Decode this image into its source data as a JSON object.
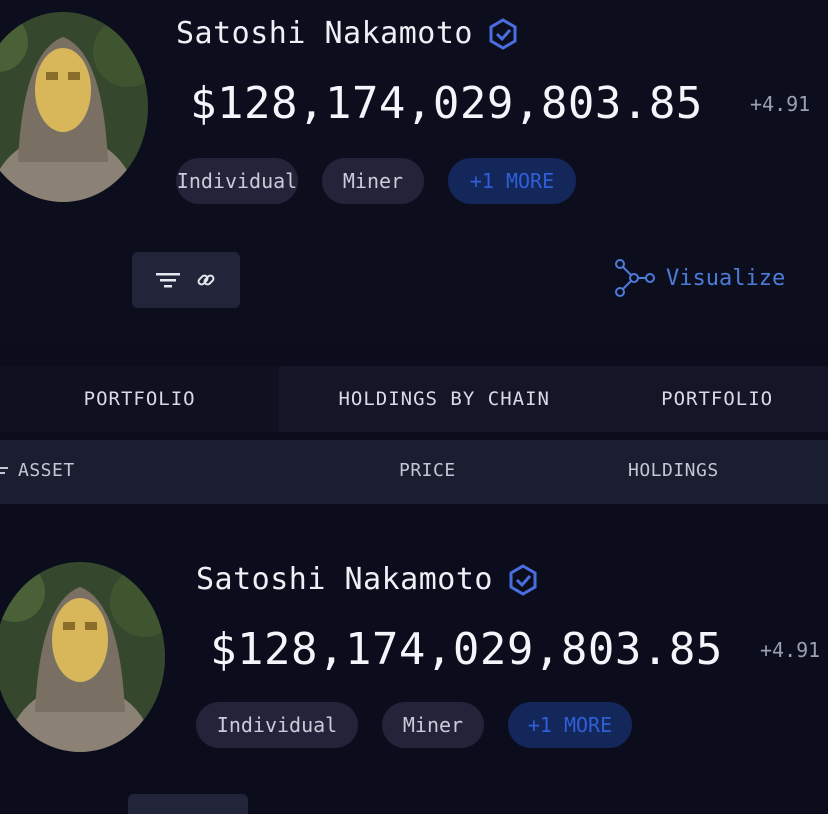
{
  "profile": {
    "name": "Satoshi Nakamoto",
    "balance": "$128,174,029,803.85",
    "change": "+4.91",
    "tags": [
      "Individual",
      "Miner"
    ],
    "more_tag": "+1 MORE"
  },
  "profile_repeat": {
    "name": "Satoshi Nakamoto",
    "balance": "$128,174,029,803.85",
    "change": "+4.91",
    "tags": [
      "Individual",
      "Miner"
    ],
    "more_tag": "+1 MORE"
  },
  "actions": {
    "visualize_label": "Visualize"
  },
  "tabs": [
    "PORTFOLIO",
    "HOLDINGS BY CHAIN",
    "PORTFOLIO"
  ],
  "table": {
    "columns": [
      "ASSET",
      "PRICE",
      "HOLDINGS"
    ]
  },
  "colors": {
    "background": "#0b0d1c",
    "accent": "#4d7bd8",
    "badge": "#4a6ee0"
  }
}
